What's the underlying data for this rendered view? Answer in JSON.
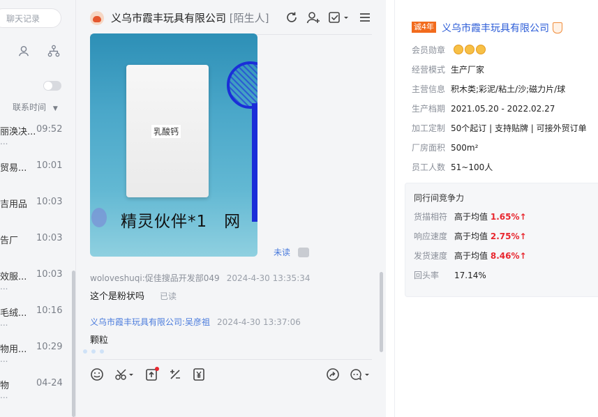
{
  "contacts_panel": {
    "search_placeholder": "聊天记录",
    "sort_label": "联系时间",
    "contacts": [
      {
        "name": "丽涣决...",
        "time": "09:52",
        "sub": "..."
      },
      {
        "name": "贸易...",
        "time": "10:01",
        "sub": ""
      },
      {
        "name": "吉用品",
        "time": "10:03",
        "sub": ""
      },
      {
        "name": "告厂",
        "time": "10:03",
        "sub": ""
      },
      {
        "name": "效服...",
        "time": "10:03",
        "sub": "..."
      },
      {
        "name": "毛绒...",
        "time": "10:16",
        "sub": "..."
      },
      {
        "name": "物用...",
        "time": "10:29",
        "sub": "..."
      },
      {
        "name": "物",
        "time": "04-24",
        "sub": "..."
      }
    ]
  },
  "chat": {
    "title": "义乌市霞丰玩具有限公司",
    "title_tag": "[陌生人]",
    "image_bag_label": "乳酸钙",
    "image_banner": "精灵伙伴*1　网",
    "unread_label": "未读",
    "messages": [
      {
        "sender": "woloveshuqi:促佳搜品开发部049",
        "time": "2024-4-30 13:35:34",
        "text": "这个是粉状吗",
        "status": "已读"
      },
      {
        "sender": "义乌市霞丰玩具有限公司:吴彦祖",
        "time": "2024-4-30 13:37:06",
        "text": "颗粒",
        "status": ""
      }
    ]
  },
  "company": {
    "year_badge": "诚4年",
    "name": "义乌市霞丰玩具有限公司",
    "rows": [
      {
        "key": "会员勋章",
        "value": ""
      },
      {
        "key": "经营模式",
        "value": "生产厂家"
      },
      {
        "key": "主营信息",
        "value": "积木类;彩泥/粘土/沙;磁力片/球"
      },
      {
        "key": "生产档期",
        "value": "2021.05.20 - 2022.02.27"
      },
      {
        "key": "加工定制",
        "value": "50个起订 | 支持贴牌 | 可接外贸订单"
      },
      {
        "key": "厂房面积",
        "value": "500m²"
      },
      {
        "key": "员工人数",
        "value": "51~100人"
      }
    ],
    "competitiveness": {
      "title": "同行间竞争力",
      "rows": [
        {
          "key": "货描相符",
          "prefix": "高于均值",
          "pct": "1.65%",
          "arrow": "↑"
        },
        {
          "key": "响应速度",
          "prefix": "高于均值",
          "pct": "2.75%",
          "arrow": "↑"
        },
        {
          "key": "发货速度",
          "prefix": "高于均值",
          "pct": "8.46%",
          "arrow": "↑"
        },
        {
          "key": "回头率",
          "prefix": "17.14%",
          "pct": "",
          "arrow": ""
        }
      ]
    }
  },
  "colors": {
    "accent_blue": "#2a5bd7",
    "highlight_red": "#e8272f",
    "badge_orange": "#f26b1d"
  }
}
